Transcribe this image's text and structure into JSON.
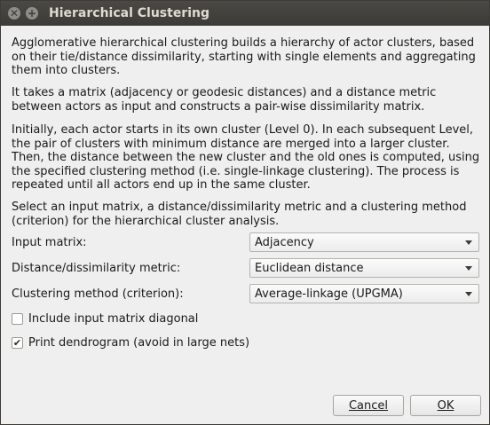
{
  "window": {
    "title": "Hierarchical Clustering",
    "close_glyph": "✕",
    "maximize_glyph": "+"
  },
  "intro": {
    "p1": "Agglomerative hierarchical clustering builds a hierarchy of actor clusters, based on their tie/distance dissimilarity, starting with single elements and aggregating them into clusters.",
    "p2": "It takes a matrix (adjacency or geodesic distances) and a distance metric between actors as input and constructs a pair-wise dissimilarity matrix.",
    "p3": "Initially, each actor starts in its own cluster (Level 0). In each subsequent Level, the pair of clusters with minimum distance are merged into a larger cluster. Then, the distance between the new cluster and the old ones is computed, using the specified clustering method (i.e. single-linkage clustering). The process is repeated until all actors end up in the same cluster.",
    "p4": "Select an input matrix, a distance/dissimilarity metric and a clustering method (criterion) for the hierarchical cluster analysis."
  },
  "form": {
    "input_matrix": {
      "label": "Input matrix:",
      "value": "Adjacency"
    },
    "metric": {
      "label": "Distance/dissimilarity metric:",
      "value": "Euclidean distance"
    },
    "method": {
      "label": "Clustering method (criterion):",
      "value": "Average-linkage (UPGMA)"
    },
    "diagonal": {
      "label": "Include input matrix diagonal",
      "checked": false
    },
    "dendrogram": {
      "label": "Print dendrogram (avoid in large nets)",
      "checked": true,
      "mark": "✔"
    }
  },
  "buttons": {
    "cancel": "Cancel",
    "ok": "OK"
  }
}
